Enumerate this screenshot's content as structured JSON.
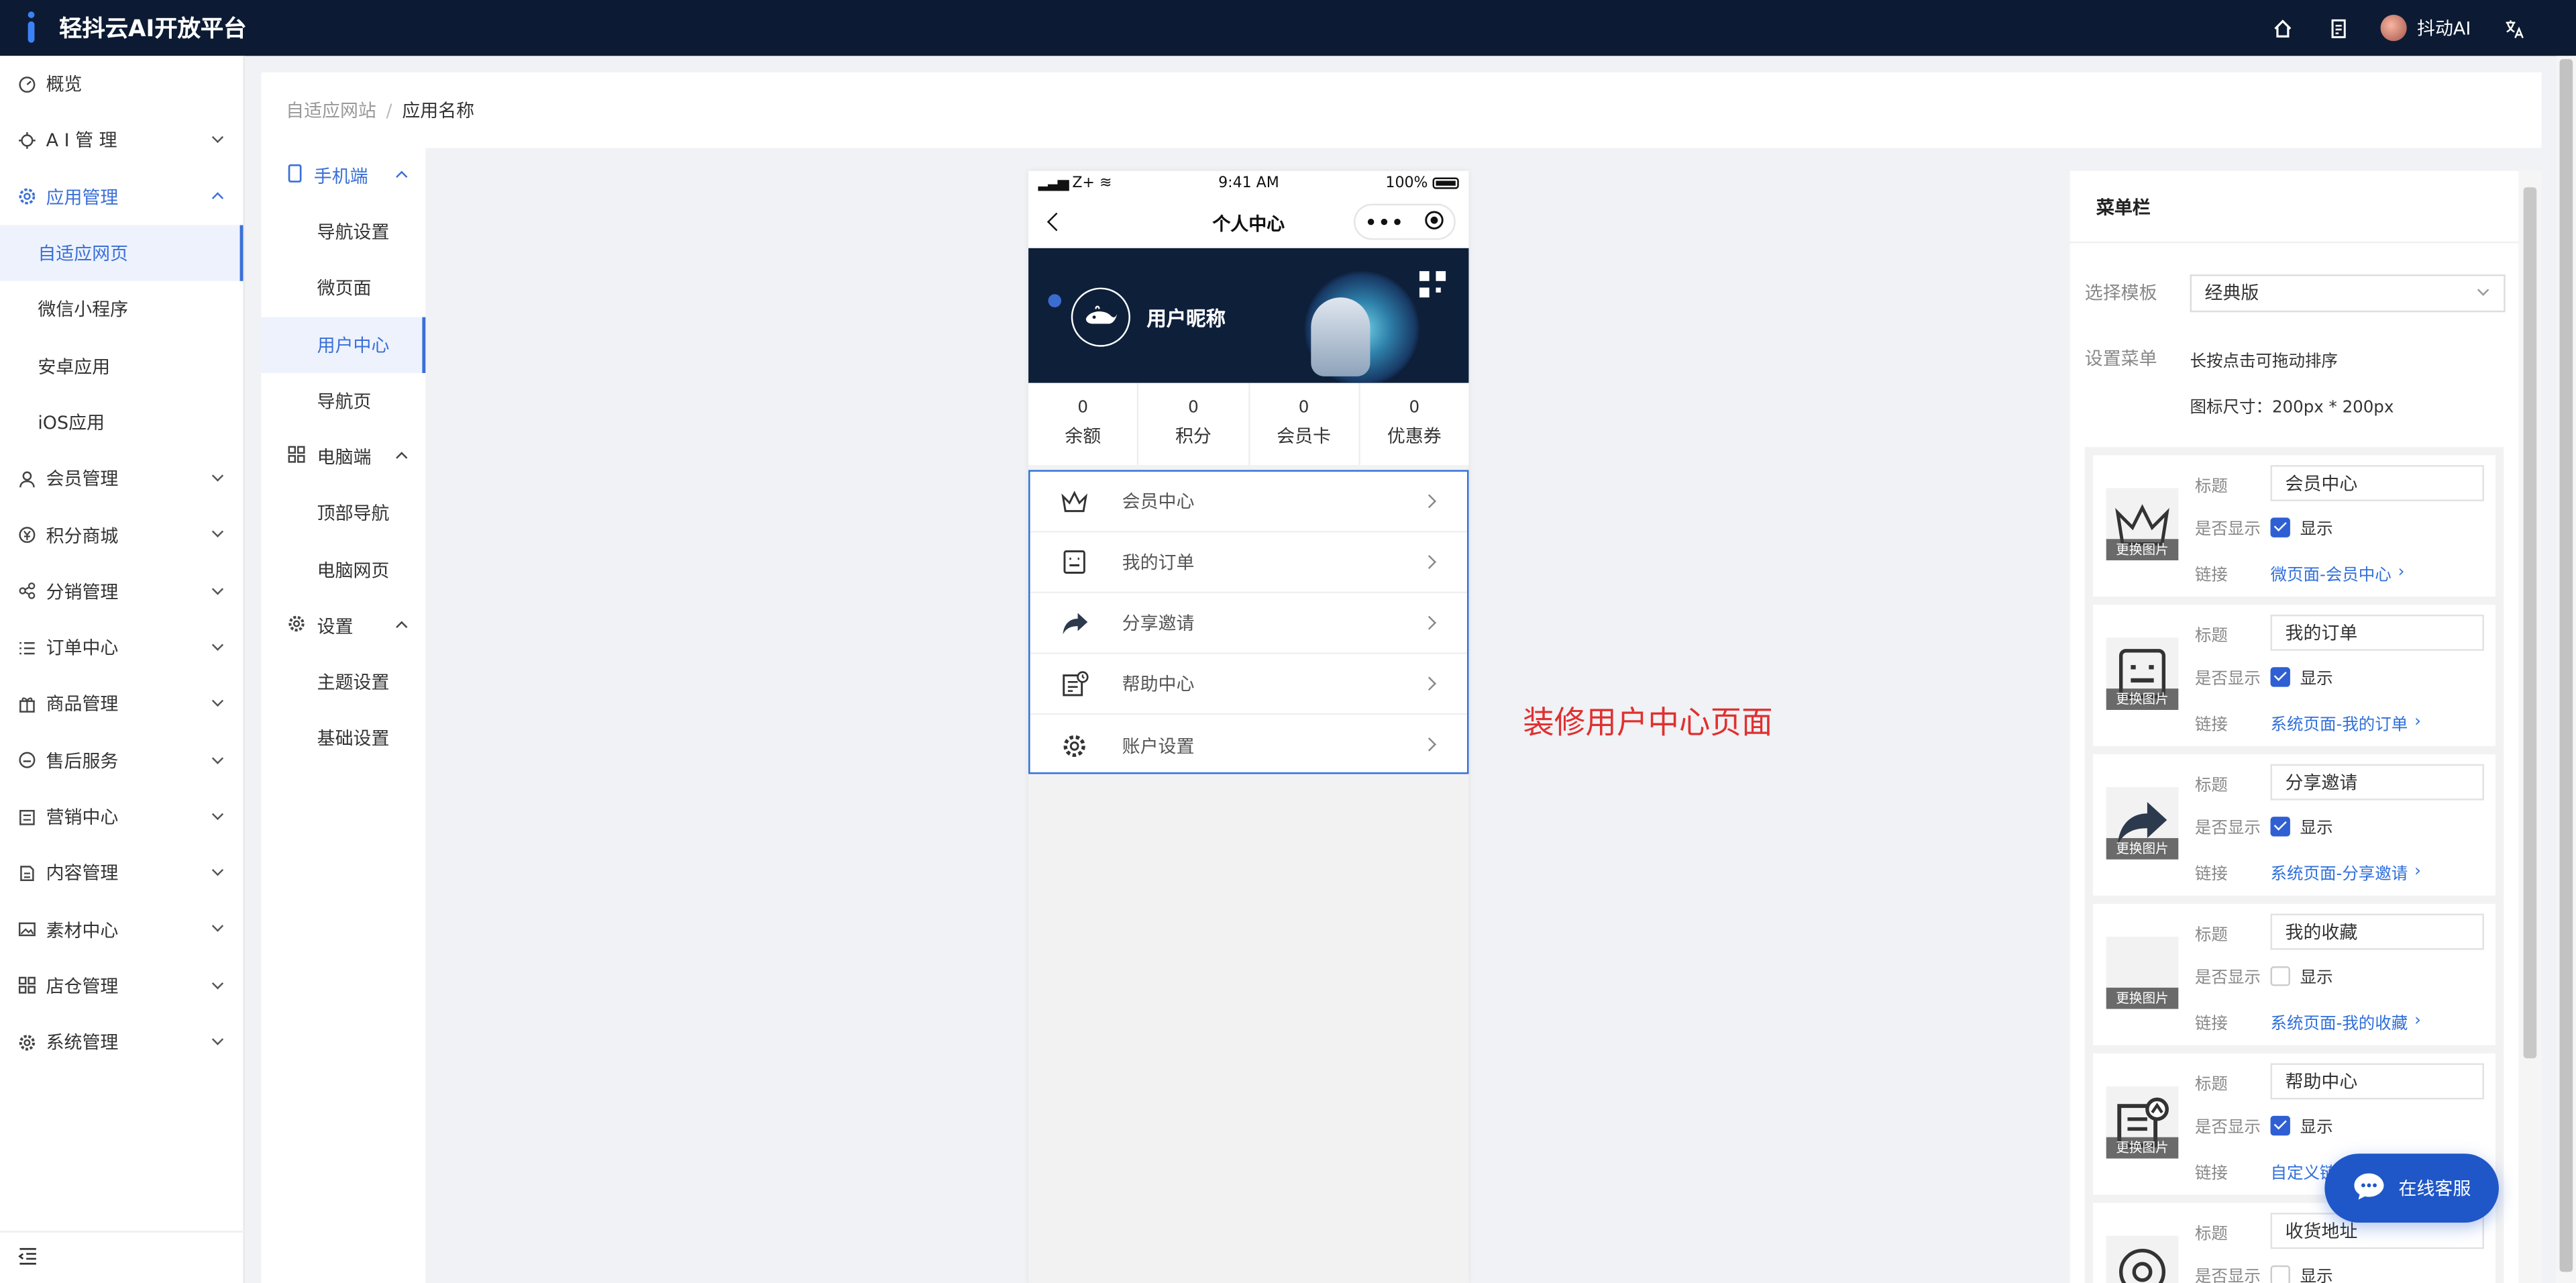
{
  "app": {
    "title": "轻抖云AI开放平台"
  },
  "topbar": {
    "user_name": "抖动AI"
  },
  "sidebar": {
    "items": [
      {
        "label": "概览",
        "icon": "dashboard-icon",
        "expandable": false
      },
      {
        "label": "A I 管 理",
        "icon": "ai-icon",
        "expandable": true
      },
      {
        "label": "应用管理",
        "icon": "app-gear-icon",
        "expandable": true,
        "expanded": true,
        "active": true
      }
    ],
    "app_children": [
      "自适应网页",
      "微信小程序",
      "安卓应用",
      "iOS应用"
    ],
    "rest": [
      {
        "label": "会员管理",
        "icon": "user-icon"
      },
      {
        "label": "积分商城",
        "icon": "coin-icon"
      },
      {
        "label": "分销管理",
        "icon": "share-icon"
      },
      {
        "label": "订单中心",
        "icon": "list-icon"
      },
      {
        "label": "商品管理",
        "icon": "gift-icon"
      },
      {
        "label": "售后服务",
        "icon": "service-icon"
      },
      {
        "label": "营销中心",
        "icon": "marketing-icon"
      },
      {
        "label": "内容管理",
        "icon": "content-icon"
      },
      {
        "label": "素材中心",
        "icon": "image-icon"
      },
      {
        "label": "店仓管理",
        "icon": "grid-icon"
      },
      {
        "label": "系统管理",
        "icon": "settings-icon"
      }
    ]
  },
  "breadcrumb": {
    "parent": "自适应网站",
    "separator": "/",
    "current": "应用名称"
  },
  "subnav": {
    "groups": [
      {
        "label": "手机端",
        "icon": "mobile-icon",
        "items": [
          "导航设置",
          "微页面",
          "用户中心",
          "导航页"
        ]
      },
      {
        "label": "电脑端",
        "icon": "desktop-icon",
        "items": [
          "顶部导航",
          "电脑网页"
        ]
      },
      {
        "label": "设置",
        "icon": "settings-icon",
        "items": [
          "主题设置",
          "基础设置"
        ]
      }
    ],
    "selected": "用户中心"
  },
  "phone": {
    "status": {
      "signal": "Z+",
      "time": "9:41 AM",
      "battery": "100%"
    },
    "title": "个人中心",
    "nickname": "用户昵称",
    "stats": [
      {
        "value": "0",
        "label": "余额"
      },
      {
        "value": "0",
        "label": "积分"
      },
      {
        "value": "0",
        "label": "会员卡"
      },
      {
        "value": "0",
        "label": "优惠券"
      }
    ],
    "menu": [
      {
        "label": "会员中心",
        "icon": "crown-icon"
      },
      {
        "label": "我的订单",
        "icon": "order-icon"
      },
      {
        "label": "分享邀请",
        "icon": "share-arrow-icon"
      },
      {
        "label": "帮助中心",
        "icon": "help-doc-icon"
      },
      {
        "label": "账户设置",
        "icon": "gear-icon"
      }
    ]
  },
  "caption": "装修用户中心页面",
  "panel": {
    "title": "菜单栏",
    "template_label": "选择模板",
    "template_value": "经典版",
    "menu_label": "设置菜单",
    "menu_hint": "长按点击可拖动排序",
    "size_hint": "图标尺寸：200px * 200px",
    "field_title": "标题",
    "field_show": "是否显示",
    "field_link": "链接",
    "show_text": "显示",
    "change_image": "更换图片",
    "cards": [
      {
        "title": "会员中心",
        "show": true,
        "link": "微页面-会员中心",
        "icon": "crown-icon"
      },
      {
        "title": "我的订单",
        "show": true,
        "link": "系统页面-我的订单",
        "icon": "order-icon"
      },
      {
        "title": "分享邀请",
        "show": true,
        "link": "系统页面-分享邀请",
        "icon": "share-arrow-icon"
      },
      {
        "title": "我的收藏",
        "show": false,
        "link": "系统页面-我的收藏",
        "icon": "blank-icon"
      },
      {
        "title": "帮助中心",
        "show": true,
        "link": "自定义链",
        "icon": "help-doc-icon"
      },
      {
        "title": "收货地址",
        "show": false,
        "link": "",
        "icon": "location-icon"
      }
    ]
  },
  "service_button": {
    "label": "在线客服"
  },
  "colors": {
    "topbar": "#0c1b33",
    "accent": "#3a6fd8",
    "caption": "#e03030",
    "service": "#1f57c8"
  }
}
